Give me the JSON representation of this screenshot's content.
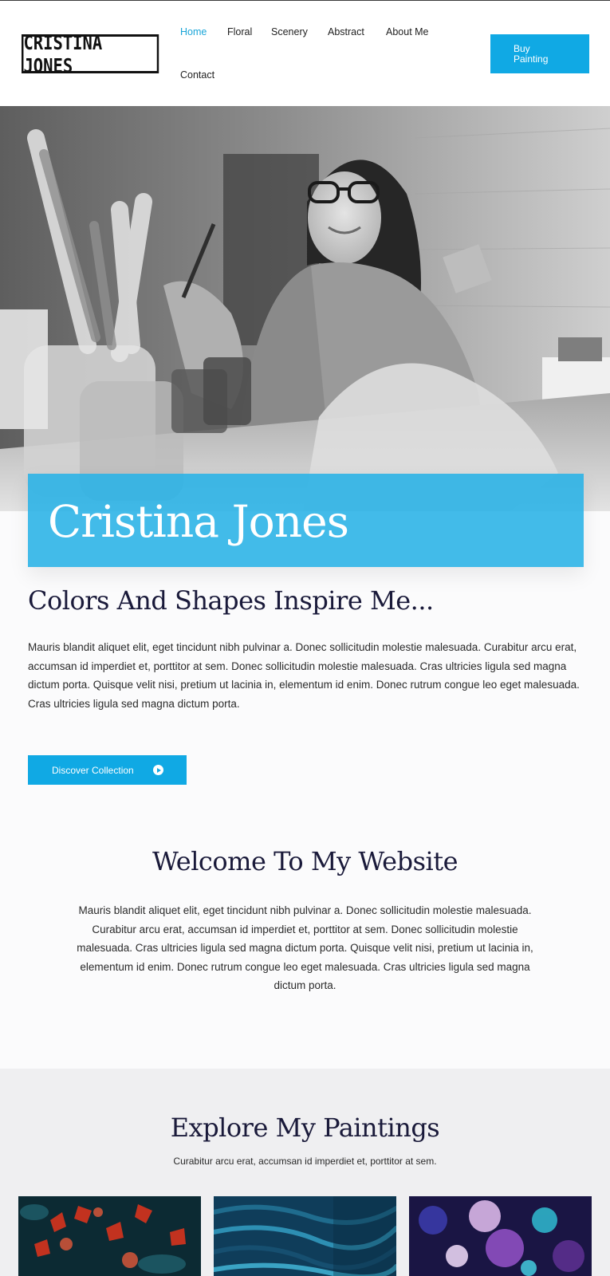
{
  "header": {
    "logo_text": "CRISTINA JONES",
    "nav": [
      {
        "label": "Home",
        "active": true
      },
      {
        "label": "Floral",
        "active": false
      },
      {
        "label": "Scenery",
        "active": false
      },
      {
        "label": "Abstract",
        "active": false
      },
      {
        "label": "About Me",
        "active": false
      },
      {
        "label": "Contact",
        "active": false
      }
    ],
    "buy_button": "Buy Painting"
  },
  "hero": {
    "name": "Cristina Jones"
  },
  "intro": {
    "title": "Colors And Shapes Inspire Me...",
    "text": "Mauris blandit aliquet elit, eget tincidunt nibh pulvinar a. Donec sollicitudin molestie malesuada. Curabitur arcu erat, accumsan id imperdiet et, porttitor at sem. Donec sollicitudin molestie malesuada. Cras ultricies ligula sed magna dictum porta. Quisque velit nisi, pretium ut lacinia in, elementum id enim. Donec rutrum congue leo eget malesuada. Cras ultricies ligula sed magna dictum porta.",
    "button": "Discover Collection",
    "button_icon": "play-circle-icon"
  },
  "welcome": {
    "title": "Welcome To My Website",
    "text": "Mauris blandit aliquet elit, eget tincidunt nibh pulvinar a. Donec sollicitudin molestie malesuada. Curabitur arcu erat, accumsan id imperdiet et, porttitor at sem. Donec sollicitudin molestie malesuada. Cras ultricies ligula sed magna dictum porta. Quisque velit nisi, pretium ut lacinia in, elementum id enim. Donec rutrum congue leo eget malesuada. Cras ultricies ligula sed magna dictum porta."
  },
  "explore": {
    "title": "Explore My Paintings",
    "subtitle": "Curabitur arcu erat, accumsan id imperdiet et, porttitor at sem."
  },
  "colors": {
    "accent": "#10a9e4",
    "heading": "#1a1a3a"
  }
}
